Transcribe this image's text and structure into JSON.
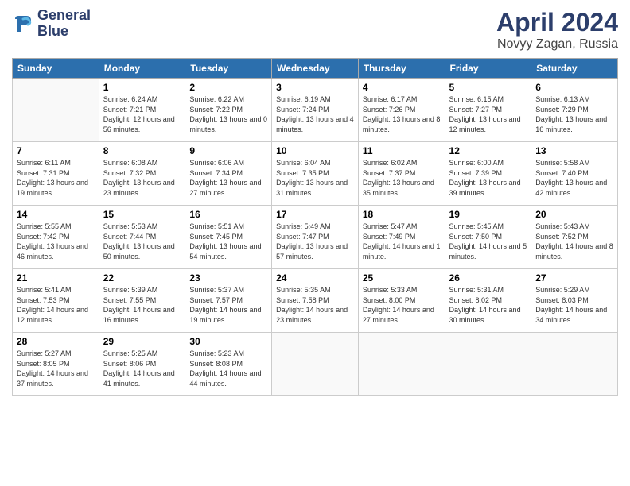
{
  "logo": {
    "line1": "General",
    "line2": "Blue"
  },
  "header": {
    "month_year": "April 2024",
    "location": "Novyy Zagan, Russia"
  },
  "days_of_week": [
    "Sunday",
    "Monday",
    "Tuesday",
    "Wednesday",
    "Thursday",
    "Friday",
    "Saturday"
  ],
  "weeks": [
    [
      {
        "day": "",
        "sunrise": "",
        "sunset": "",
        "daylight": ""
      },
      {
        "day": "1",
        "sunrise": "Sunrise: 6:24 AM",
        "sunset": "Sunset: 7:21 PM",
        "daylight": "Daylight: 12 hours and 56 minutes."
      },
      {
        "day": "2",
        "sunrise": "Sunrise: 6:22 AM",
        "sunset": "Sunset: 7:22 PM",
        "daylight": "Daylight: 13 hours and 0 minutes."
      },
      {
        "day": "3",
        "sunrise": "Sunrise: 6:19 AM",
        "sunset": "Sunset: 7:24 PM",
        "daylight": "Daylight: 13 hours and 4 minutes."
      },
      {
        "day": "4",
        "sunrise": "Sunrise: 6:17 AM",
        "sunset": "Sunset: 7:26 PM",
        "daylight": "Daylight: 13 hours and 8 minutes."
      },
      {
        "day": "5",
        "sunrise": "Sunrise: 6:15 AM",
        "sunset": "Sunset: 7:27 PM",
        "daylight": "Daylight: 13 hours and 12 minutes."
      },
      {
        "day": "6",
        "sunrise": "Sunrise: 6:13 AM",
        "sunset": "Sunset: 7:29 PM",
        "daylight": "Daylight: 13 hours and 16 minutes."
      }
    ],
    [
      {
        "day": "7",
        "sunrise": "Sunrise: 6:11 AM",
        "sunset": "Sunset: 7:31 PM",
        "daylight": "Daylight: 13 hours and 19 minutes."
      },
      {
        "day": "8",
        "sunrise": "Sunrise: 6:08 AM",
        "sunset": "Sunset: 7:32 PM",
        "daylight": "Daylight: 13 hours and 23 minutes."
      },
      {
        "day": "9",
        "sunrise": "Sunrise: 6:06 AM",
        "sunset": "Sunset: 7:34 PM",
        "daylight": "Daylight: 13 hours and 27 minutes."
      },
      {
        "day": "10",
        "sunrise": "Sunrise: 6:04 AM",
        "sunset": "Sunset: 7:35 PM",
        "daylight": "Daylight: 13 hours and 31 minutes."
      },
      {
        "day": "11",
        "sunrise": "Sunrise: 6:02 AM",
        "sunset": "Sunset: 7:37 PM",
        "daylight": "Daylight: 13 hours and 35 minutes."
      },
      {
        "day": "12",
        "sunrise": "Sunrise: 6:00 AM",
        "sunset": "Sunset: 7:39 PM",
        "daylight": "Daylight: 13 hours and 39 minutes."
      },
      {
        "day": "13",
        "sunrise": "Sunrise: 5:58 AM",
        "sunset": "Sunset: 7:40 PM",
        "daylight": "Daylight: 13 hours and 42 minutes."
      }
    ],
    [
      {
        "day": "14",
        "sunrise": "Sunrise: 5:55 AM",
        "sunset": "Sunset: 7:42 PM",
        "daylight": "Daylight: 13 hours and 46 minutes."
      },
      {
        "day": "15",
        "sunrise": "Sunrise: 5:53 AM",
        "sunset": "Sunset: 7:44 PM",
        "daylight": "Daylight: 13 hours and 50 minutes."
      },
      {
        "day": "16",
        "sunrise": "Sunrise: 5:51 AM",
        "sunset": "Sunset: 7:45 PM",
        "daylight": "Daylight: 13 hours and 54 minutes."
      },
      {
        "day": "17",
        "sunrise": "Sunrise: 5:49 AM",
        "sunset": "Sunset: 7:47 PM",
        "daylight": "Daylight: 13 hours and 57 minutes."
      },
      {
        "day": "18",
        "sunrise": "Sunrise: 5:47 AM",
        "sunset": "Sunset: 7:49 PM",
        "daylight": "Daylight: 14 hours and 1 minute."
      },
      {
        "day": "19",
        "sunrise": "Sunrise: 5:45 AM",
        "sunset": "Sunset: 7:50 PM",
        "daylight": "Daylight: 14 hours and 5 minutes."
      },
      {
        "day": "20",
        "sunrise": "Sunrise: 5:43 AM",
        "sunset": "Sunset: 7:52 PM",
        "daylight": "Daylight: 14 hours and 8 minutes."
      }
    ],
    [
      {
        "day": "21",
        "sunrise": "Sunrise: 5:41 AM",
        "sunset": "Sunset: 7:53 PM",
        "daylight": "Daylight: 14 hours and 12 minutes."
      },
      {
        "day": "22",
        "sunrise": "Sunrise: 5:39 AM",
        "sunset": "Sunset: 7:55 PM",
        "daylight": "Daylight: 14 hours and 16 minutes."
      },
      {
        "day": "23",
        "sunrise": "Sunrise: 5:37 AM",
        "sunset": "Sunset: 7:57 PM",
        "daylight": "Daylight: 14 hours and 19 minutes."
      },
      {
        "day": "24",
        "sunrise": "Sunrise: 5:35 AM",
        "sunset": "Sunset: 7:58 PM",
        "daylight": "Daylight: 14 hours and 23 minutes."
      },
      {
        "day": "25",
        "sunrise": "Sunrise: 5:33 AM",
        "sunset": "Sunset: 8:00 PM",
        "daylight": "Daylight: 14 hours and 27 minutes."
      },
      {
        "day": "26",
        "sunrise": "Sunrise: 5:31 AM",
        "sunset": "Sunset: 8:02 PM",
        "daylight": "Daylight: 14 hours and 30 minutes."
      },
      {
        "day": "27",
        "sunrise": "Sunrise: 5:29 AM",
        "sunset": "Sunset: 8:03 PM",
        "daylight": "Daylight: 14 hours and 34 minutes."
      }
    ],
    [
      {
        "day": "28",
        "sunrise": "Sunrise: 5:27 AM",
        "sunset": "Sunset: 8:05 PM",
        "daylight": "Daylight: 14 hours and 37 minutes."
      },
      {
        "day": "29",
        "sunrise": "Sunrise: 5:25 AM",
        "sunset": "Sunset: 8:06 PM",
        "daylight": "Daylight: 14 hours and 41 minutes."
      },
      {
        "day": "30",
        "sunrise": "Sunrise: 5:23 AM",
        "sunset": "Sunset: 8:08 PM",
        "daylight": "Daylight: 14 hours and 44 minutes."
      },
      {
        "day": "",
        "sunrise": "",
        "sunset": "",
        "daylight": ""
      },
      {
        "day": "",
        "sunrise": "",
        "sunset": "",
        "daylight": ""
      },
      {
        "day": "",
        "sunrise": "",
        "sunset": "",
        "daylight": ""
      },
      {
        "day": "",
        "sunrise": "",
        "sunset": "",
        "daylight": ""
      }
    ]
  ]
}
